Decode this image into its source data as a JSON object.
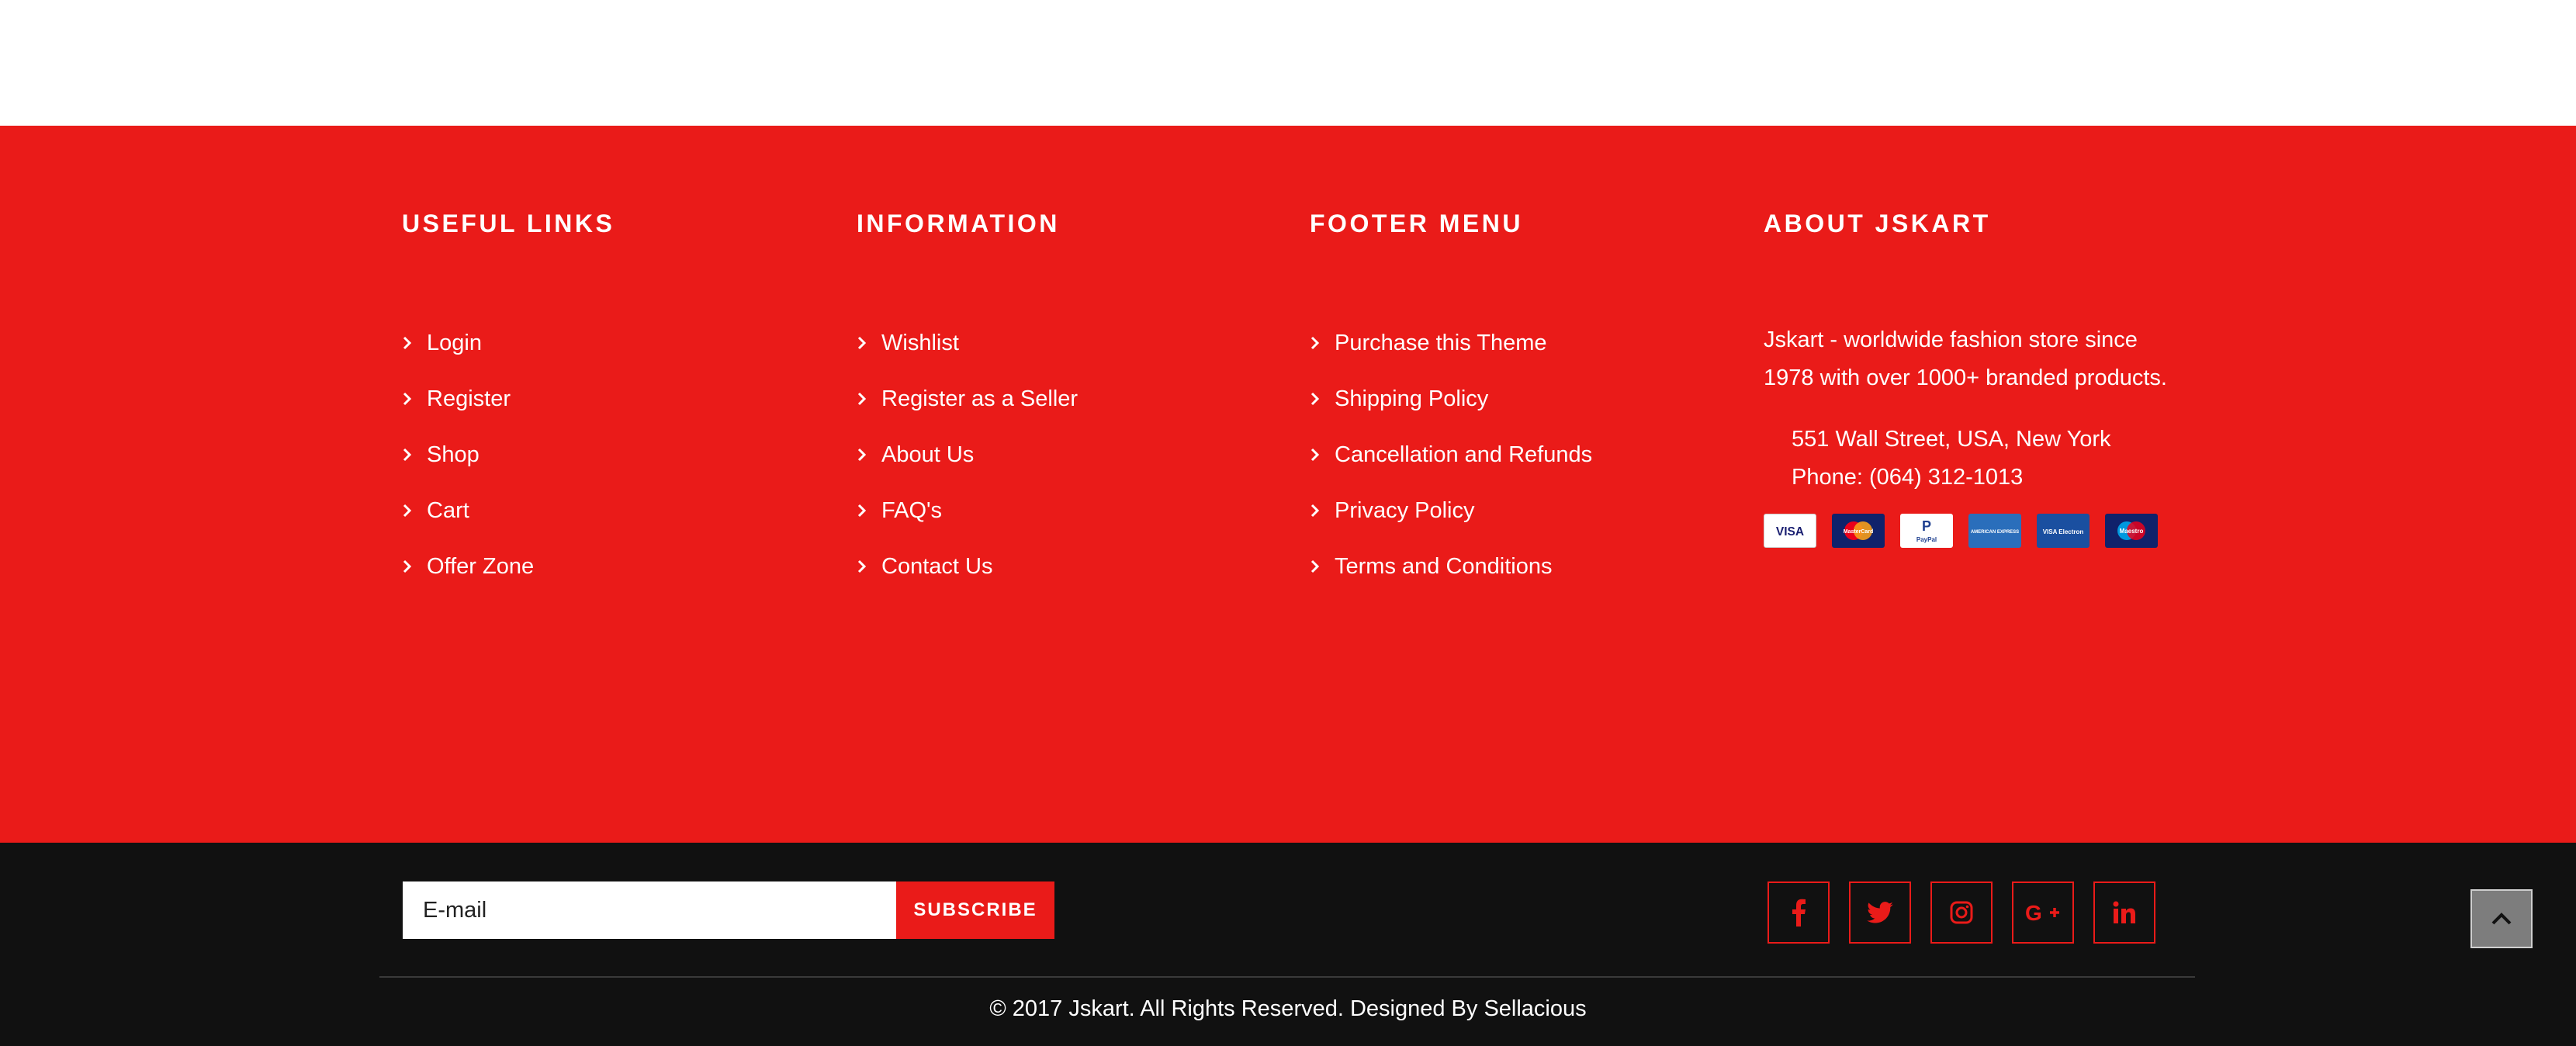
{
  "colors": {
    "accent": "#ea1b19",
    "dark": "#111111",
    "text": "#ffffff"
  },
  "columns": {
    "useful_links": {
      "title": "USEFUL LINKS",
      "items": [
        {
          "label": "Login"
        },
        {
          "label": "Register"
        },
        {
          "label": "Shop"
        },
        {
          "label": "Cart"
        },
        {
          "label": "Offer Zone"
        }
      ]
    },
    "information": {
      "title": "INFORMATION",
      "items": [
        {
          "label": "Wishlist"
        },
        {
          "label": "Register as a Seller"
        },
        {
          "label": "About Us"
        },
        {
          "label": "FAQ's"
        },
        {
          "label": "Contact Us"
        }
      ]
    },
    "footer_menu": {
      "title": "FOOTER MENU",
      "items": [
        {
          "label": "Purchase this Theme"
        },
        {
          "label": "Shipping Policy"
        },
        {
          "label": "Cancellation and Refunds"
        },
        {
          "label": "Privacy Policy"
        },
        {
          "label": "Terms and Conditions"
        }
      ]
    },
    "about": {
      "title": "ABOUT JSKART",
      "description_line1": "Jskart - worldwide fashion store since",
      "description_line2": "1978 with over 1000+ branded products.",
      "address": "551 Wall Street, USA, New York",
      "phone": "Phone: (064) 312-1013",
      "payment_cards": [
        {
          "icon": "visa-card-icon",
          "text": "VISA"
        },
        {
          "icon": "mastercard-card-icon",
          "text": "MasterCard"
        },
        {
          "icon": "paypal-card-icon",
          "text": "PayPal"
        },
        {
          "icon": "american-express-card-icon",
          "text": "AMERICAN EXPRESS"
        },
        {
          "icon": "visa-electron-card-icon",
          "text": "VISA Electron"
        },
        {
          "icon": "maestro-card-icon",
          "text": "Maestro"
        }
      ]
    }
  },
  "newsletter": {
    "placeholder": "E-mail",
    "button_label": "SUBSCRIBE"
  },
  "social": [
    {
      "icon": "facebook-icon"
    },
    {
      "icon": "twitter-icon"
    },
    {
      "icon": "instagram-icon"
    },
    {
      "icon": "google-plus-icon"
    },
    {
      "icon": "linkedin-icon"
    }
  ],
  "copyright": "© 2017 Jskart. All Rights Reserved. Designed By Sellacious",
  "back_to_top_icon": "chevron-up-icon"
}
